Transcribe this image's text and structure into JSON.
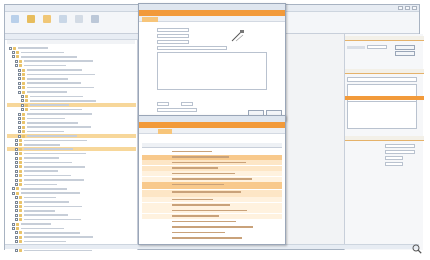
{
  "app": {
    "title": "",
    "colors": {
      "accent": "#f29a3a",
      "highlight": "#f7d79a",
      "chrome": "#e7ecf3"
    }
  },
  "ribbon": {
    "buttons": [
      {
        "icon": "document-icon"
      },
      {
        "icon": "folder-icon"
      },
      {
        "icon": "table-icon"
      },
      {
        "icon": "copy-icon"
      },
      {
        "icon": "chart-icon"
      },
      {
        "icon": "tools-icon"
      }
    ]
  },
  "tree": {
    "rows": 47,
    "highlight_rows": [
      13,
      20,
      23
    ]
  },
  "dialog": {
    "tabs": [
      {
        "label": ""
      },
      {
        "label": ""
      }
    ]
  },
  "table": {
    "rows": 16
  },
  "right_panel": {
    "sections": [
      {
        "label": ""
      },
      {
        "label": ""
      },
      {
        "label": ""
      }
    ]
  },
  "zoom_icon": "magnify-icon"
}
